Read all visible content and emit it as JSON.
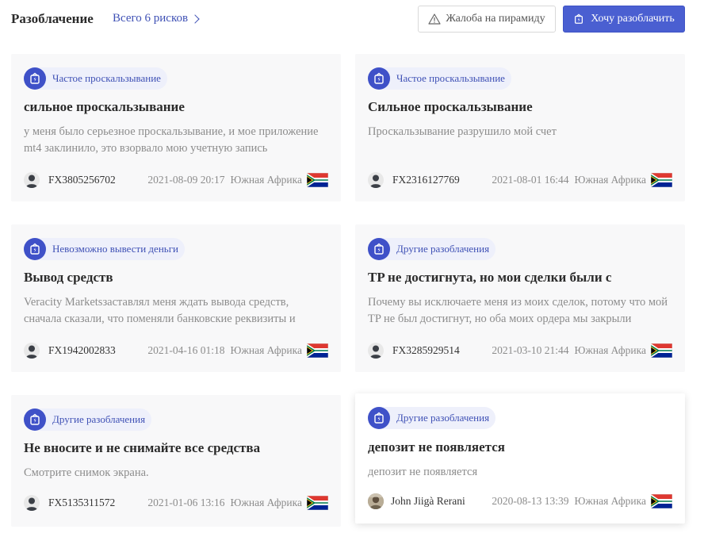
{
  "header": {
    "title": "Разоблачение",
    "total_link": "Всего 6 рисков",
    "complaint_button": "Жалоба на пирамиду",
    "expose_button": "Хочу разоблачить"
  },
  "cards": [
    {
      "tag": "Частое проскальзывание",
      "title": "сильное проскальзывание",
      "text": "у меня было серьезное проскальзывание, и мое приложение mt4 заклинило, это взорвало мою учетную запись",
      "user": "FX3805256702",
      "date": "2021-08-09 20:17",
      "country": "Южная Африка"
    },
    {
      "tag": "Частое проскальзывание",
      "title": "Сильное проскальзывание",
      "text": "Проскальзывание разрушило мой счет",
      "user": "FX2316127769",
      "date": "2021-08-01 16:44",
      "country": "Южная Африка"
    },
    {
      "tag": "Невозможно вывести деньги",
      "title": "Вывод средств",
      "text": "Veracity Marketsзаставлял меня ждать вывода средств, сначала сказали, что поменяли банковские реквизиты и нужно подождать",
      "user": "FX1942002833",
      "date": "2021-04-16 01:18",
      "country": "Южная Африка"
    },
    {
      "tag": "Другие разоблачения",
      "title": "TP не достигнута, но мои сделки были с",
      "text": "Почему вы исключаете меня из моих сделок, потому что мой TP не был достигнут, но оба моих ордера мы закрыли",
      "user": "FX3285929514",
      "date": "2021-03-10 21:44",
      "country": "Южная Африка"
    },
    {
      "tag": "Другие разоблачения",
      "title": "Не вносите и не снимайте все средства",
      "text": "Смотрите снимок экрана.",
      "user": "FX5135311572",
      "date": "2021-01-06 13:16",
      "country": "Южная Африка"
    },
    {
      "tag": "Другие разоблачения",
      "title": "депозит не появляется",
      "text": "депозит не появляется",
      "user": "John Jiigà Rerani",
      "date": "2020-08-13 13:39",
      "country": "Южная Африка"
    }
  ]
}
